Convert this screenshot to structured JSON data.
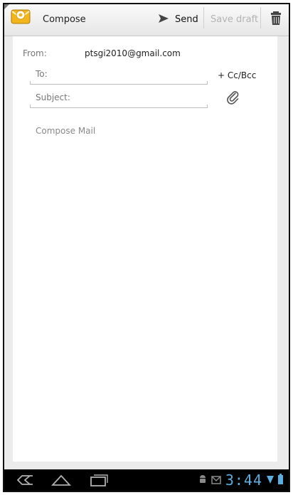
{
  "action_bar": {
    "title": "Compose",
    "send_label": "Send",
    "save_draft_label": "Save draft"
  },
  "form": {
    "from_label": "From:",
    "from_value": "ptsgi2010@gmail.com",
    "to_placeholder": "To:",
    "cc_bcc_label": "+ Cc/Bcc",
    "subject_placeholder": "Subject:",
    "body_placeholder": "Compose Mail"
  },
  "system_bar": {
    "time": "3:44",
    "accent_color": "#5aaee0"
  },
  "icons": [
    "mail-app-icon",
    "send-icon",
    "trash-icon",
    "attach-icon",
    "back-icon",
    "home-icon",
    "recent-apps-icon",
    "android-icon",
    "gmail-notification-icon",
    "wifi-icon",
    "battery-icon"
  ]
}
